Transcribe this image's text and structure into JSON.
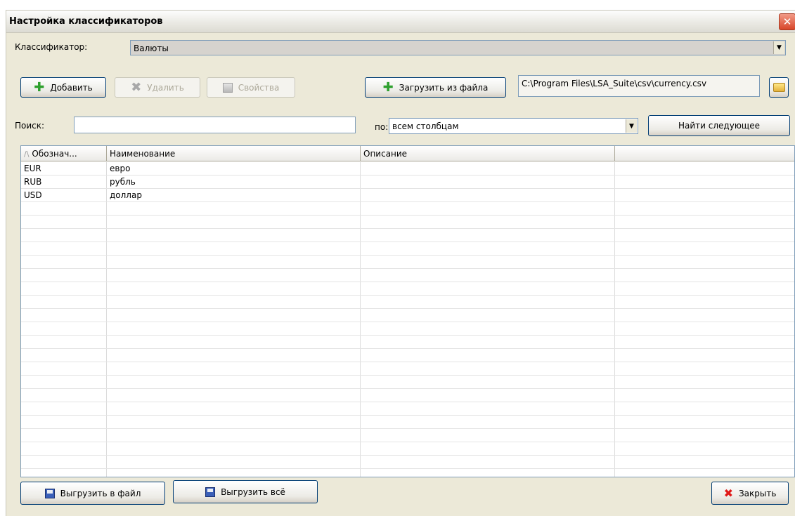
{
  "window": {
    "title": "Настройка классификаторов",
    "close_symbol": "✕"
  },
  "classifier": {
    "label": "Классификатор:",
    "value": "Валюты"
  },
  "toolbar": {
    "add_label": "Добавить",
    "delete_label": "Удалить",
    "properties_label": "Свойства",
    "load_label": "Загрузить из файла",
    "file_path": "C:\\Program Files\\LSA_Suite\\csv\\currency.csv"
  },
  "search": {
    "label": "Поиск:",
    "value": "",
    "by_label": "по:",
    "by_value": "всем столбцам",
    "find_next_label": "Найти следующее"
  },
  "table": {
    "columns": [
      "Обознач...",
      "Наименование",
      "Описание",
      ""
    ],
    "rows": [
      [
        "EUR",
        "евро",
        "",
        ""
      ],
      [
        "RUB",
        "рубль",
        "",
        ""
      ],
      [
        "USD",
        "доллар",
        "",
        ""
      ]
    ]
  },
  "footer": {
    "export_file_label": "Выгрузить в файл",
    "export_all_label": "Выгрузить всё",
    "close_label": "Закрыть"
  },
  "colors": {
    "accent_border": "#003c74",
    "window_bg": "#ece9d8",
    "field_border": "#7f9db9"
  }
}
